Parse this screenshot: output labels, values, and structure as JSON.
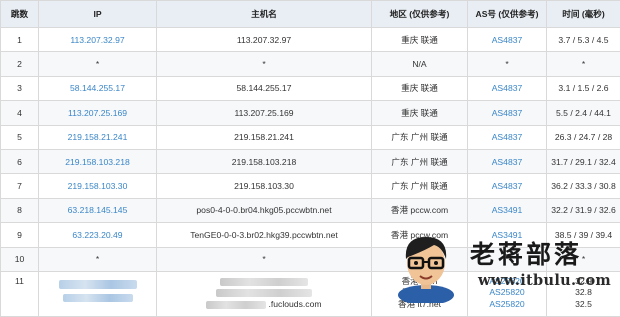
{
  "headers": {
    "hop": "跳数",
    "ip": "IP",
    "host": "主机名",
    "region": "地区 (仅供参考)",
    "asn": "AS号 (仅供参考)",
    "time": "时间 (毫秒)"
  },
  "rows": [
    {
      "hop": "1",
      "ip": "113.207.32.97",
      "host": "113.207.32.97",
      "region": "重庆 联通",
      "asn": "AS4837",
      "time": "3.7 / 5.3 / 4.5"
    },
    {
      "hop": "2",
      "ip": "*",
      "host": "*",
      "region": "N/A",
      "asn": "*",
      "time": "*"
    },
    {
      "hop": "3",
      "ip": "58.144.255.17",
      "host": "58.144.255.17",
      "region": "重庆 联通",
      "asn": "AS4837",
      "time": "3.1 / 1.5 / 2.6"
    },
    {
      "hop": "4",
      "ip": "113.207.25.169",
      "host": "113.207.25.169",
      "region": "重庆 联通",
      "asn": "AS4837",
      "time": "5.5 / 2.4 / 44.1"
    },
    {
      "hop": "5",
      "ip": "219.158.21.241",
      "host": "219.158.21.241",
      "region": "广东 广州 联通",
      "asn": "AS4837",
      "time": "26.3 / 24.7 / 28"
    },
    {
      "hop": "6",
      "ip": "219.158.103.218",
      "host": "219.158.103.218",
      "region": "广东 广州 联通",
      "asn": "AS4837",
      "time": "31.7 / 29.1 / 32.4"
    },
    {
      "hop": "7",
      "ip": "219.158.103.30",
      "host": "219.158.103.30",
      "region": "广东 广州 联通",
      "asn": "AS4837",
      "time": "36.2 / 33.3 / 30.8"
    },
    {
      "hop": "8",
      "ip": "63.218.145.145",
      "host": "pos0-4-0-0.br04.hkg05.pccwbtn.net",
      "region": "香港 pccw.com",
      "asn": "AS3491",
      "time": "32.2 / 31.9 / 32.6"
    },
    {
      "hop": "9",
      "ip": "63.223.20.49",
      "host": "TenGE0-0-0-3.br02.hkg39.pccwbtn.net",
      "region": "香港 pccw.com",
      "asn": "AS3491",
      "time": "38.5 / 39 / 39.4"
    },
    {
      "hop": "10",
      "ip": "*",
      "host": "*",
      "region": "N/A",
      "asn": "*",
      "time": "*"
    }
  ],
  "row11": {
    "hop": "11",
    "host_suffix": ".fuclouds.com",
    "regions": [
      "香港 it7.n",
      "香港 it7.n",
      "香港 it7.net"
    ],
    "asns": [
      "AS25820",
      "AS25820",
      "AS25820"
    ],
    "times": [
      "32.9",
      "32.8",
      "32.5"
    ]
  },
  "watermark": {
    "name": "老蒋部落",
    "url": "www.itbulu.com"
  }
}
